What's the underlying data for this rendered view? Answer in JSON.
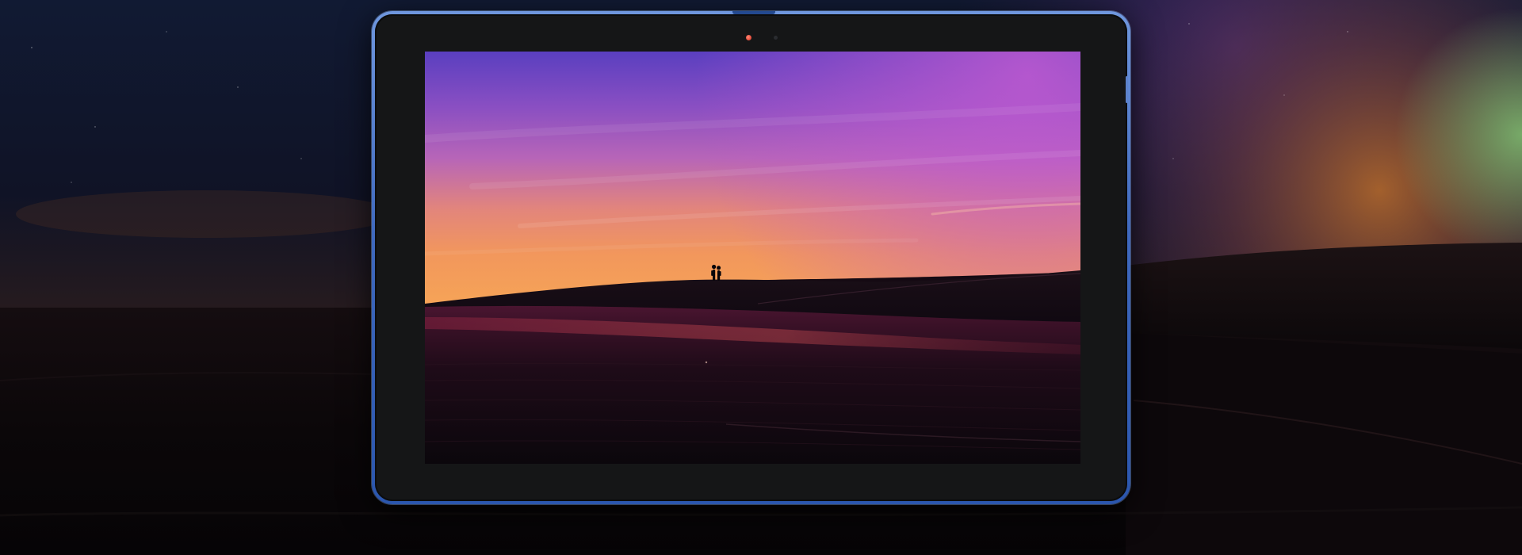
{
  "scene": {
    "subject": "tablet",
    "wallpaper": "desert-dune-sunset"
  },
  "colors": {
    "frame": "#3f69be",
    "bezel": "#151617",
    "camera_indicator": "#e8503e",
    "sky_top": "#5a3fb6",
    "sky_mid": "#b360b8",
    "sky_horizon": "#f2955e",
    "dunes": "#120912"
  },
  "icons": [
    "camera-icon",
    "silhouette-figures"
  ]
}
